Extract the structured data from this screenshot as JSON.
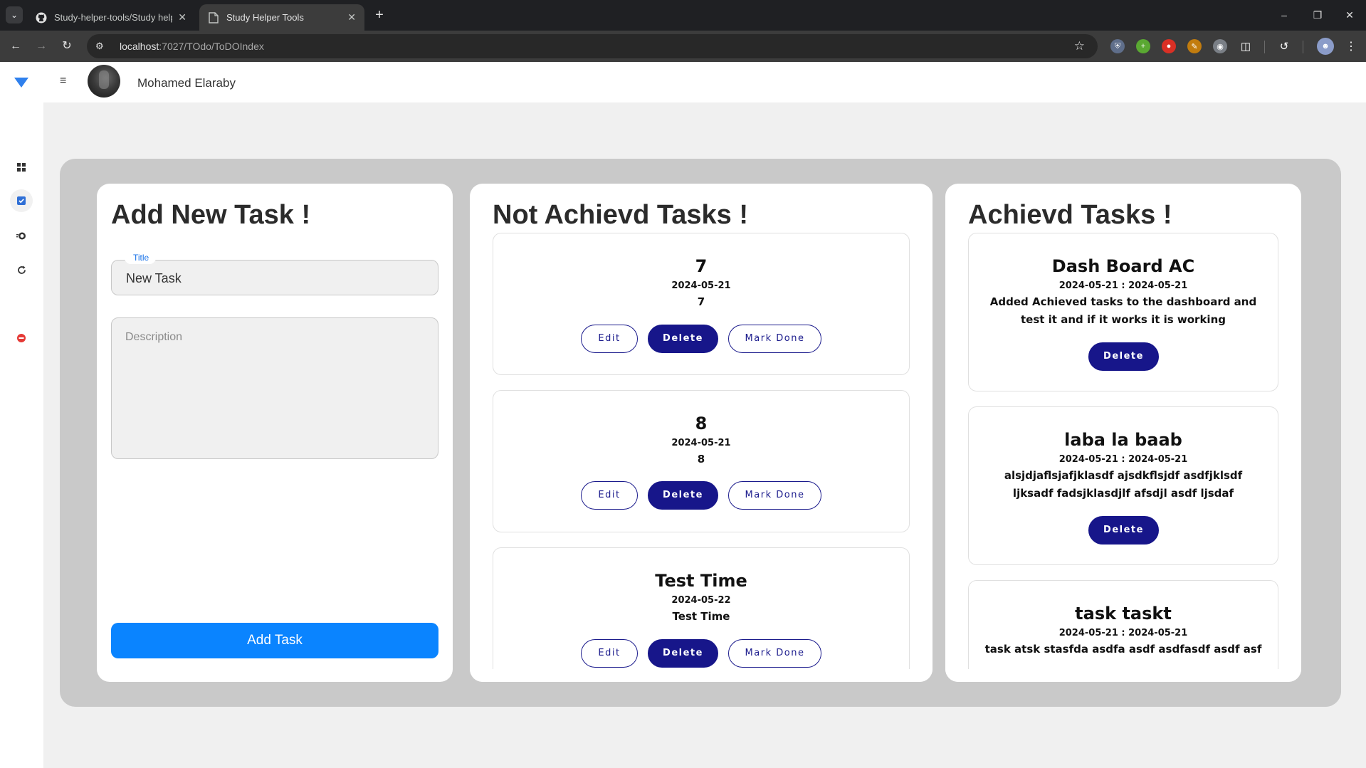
{
  "browser": {
    "tabs": [
      {
        "title": "Study-helper-tools/Study helpe",
        "icon": "github-icon",
        "active": false
      },
      {
        "title": "Study Helper Tools",
        "icon": "page-icon",
        "active": true
      }
    ],
    "url_host": "localhost",
    "url_path": ":7027/TOdo/ToDOIndex"
  },
  "header": {
    "user_name": "Mohamed Elaraby"
  },
  "sidebar": {
    "items": [
      {
        "icon": "grid-icon"
      },
      {
        "icon": "checkbox-icon",
        "active": true
      },
      {
        "icon": "timer-icon"
      },
      {
        "icon": "refresh-icon"
      },
      {
        "icon": "stop-icon"
      }
    ]
  },
  "add_panel": {
    "title": "Add New Task !",
    "title_field_label": "Title",
    "title_field_value": "New Task",
    "description_placeholder": "Description",
    "add_button": "Add Task"
  },
  "not_achieved": {
    "title": "Not Achievd Tasks !",
    "tasks": [
      {
        "title": "7",
        "date": "2024-05-21",
        "description": "7"
      },
      {
        "title": "8",
        "date": "2024-05-21",
        "description": "8"
      },
      {
        "title": "Test Time",
        "date": "2024-05-22",
        "description": "Test Time"
      }
    ],
    "edit_label": "Edit",
    "delete_label": "Delete",
    "done_label": "Mark Done"
  },
  "achieved": {
    "title": "Achievd Tasks !",
    "tasks": [
      {
        "title": "Dash Board AC",
        "date": "2024-05-21 : 2024-05-21",
        "description": "Added Achieved tasks to the dashboard and test it and if it works it is working"
      },
      {
        "title": "laba la baab",
        "date": "2024-05-21 : 2024-05-21",
        "description": "alsjdjaflsjafjklasdf ajsdkflsjdf asdfjklsdf ljksadf fadsjklasdjlf afsdjl asdf ljsdaf"
      },
      {
        "title": "task taskt",
        "date": "2024-05-21 : 2024-05-21",
        "description": "task atsk stasfda asdfa asdf asdfasdf asdf asf"
      }
    ],
    "delete_label": "Delete"
  },
  "colors": {
    "primary_button": "#0a84ff",
    "navy_button": "#17168a",
    "board_background": "#c9c9c9"
  }
}
